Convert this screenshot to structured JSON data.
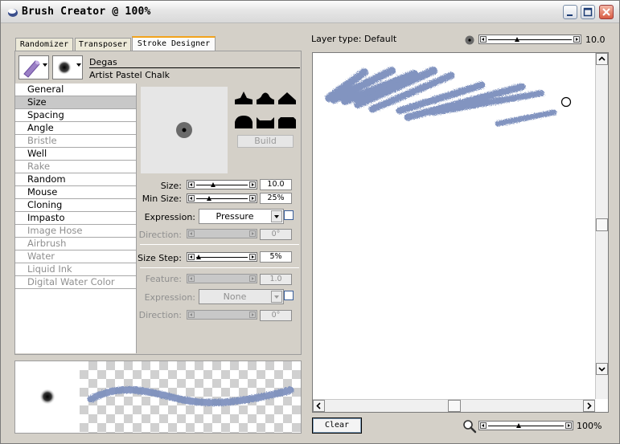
{
  "window": {
    "title": "Brush Creator @ 100%"
  },
  "tabs": [
    {
      "label": "Randomizer",
      "active": false
    },
    {
      "label": "Transposer",
      "active": false
    },
    {
      "label": "Stroke Designer",
      "active": true
    }
  ],
  "brush": {
    "category": "Degas",
    "variant": "Artist Pastel Chalk"
  },
  "categories": [
    {
      "label": "General",
      "enabled": true,
      "selected": false
    },
    {
      "label": "Size",
      "enabled": true,
      "selected": true
    },
    {
      "label": "Spacing",
      "enabled": true,
      "selected": false
    },
    {
      "label": "Angle",
      "enabled": true,
      "selected": false
    },
    {
      "label": "Bristle",
      "enabled": false,
      "selected": false
    },
    {
      "label": "Well",
      "enabled": true,
      "selected": false
    },
    {
      "label": "Rake",
      "enabled": false,
      "selected": false
    },
    {
      "label": "Random",
      "enabled": true,
      "selected": false
    },
    {
      "label": "Mouse",
      "enabled": true,
      "selected": false
    },
    {
      "label": "Cloning",
      "enabled": true,
      "selected": false
    },
    {
      "label": "Impasto",
      "enabled": true,
      "selected": false
    },
    {
      "label": "Image Hose",
      "enabled": false,
      "selected": false
    },
    {
      "label": "Airbrush",
      "enabled": false,
      "selected": false
    },
    {
      "label": "Water",
      "enabled": false,
      "selected": false
    },
    {
      "label": "Liquid Ink",
      "enabled": false,
      "selected": false
    },
    {
      "label": "Digital Water Color",
      "enabled": false,
      "selected": false
    }
  ],
  "size_panel": {
    "build_label": "Build",
    "size": {
      "label": "Size:",
      "value": "10.0",
      "fraction": 0.33
    },
    "min_size": {
      "label": "Min Size:",
      "value": "25%",
      "fraction": 0.25
    },
    "expression": {
      "label": "Expression:",
      "value": "Pressure"
    },
    "direction": {
      "label": "Direction:",
      "value": "0°"
    },
    "size_step": {
      "label": "Size Step:",
      "value": "5%",
      "fraction": 0.05
    },
    "feature": {
      "label": "Feature:",
      "value": "1.0"
    },
    "expression2": {
      "label": "Expression:",
      "value": "None"
    },
    "direction2": {
      "label": "Direction:",
      "value": "0°"
    }
  },
  "preview": {
    "layer_type": "Layer type: Default",
    "size_value": "10.0",
    "size_fraction": 0.35,
    "clear_label": "Clear",
    "zoom_value": "100%",
    "zoom_fraction": 0.4
  },
  "colors": {
    "stroke": "#7b8fbd",
    "accent_tab": "#f2a31c"
  }
}
